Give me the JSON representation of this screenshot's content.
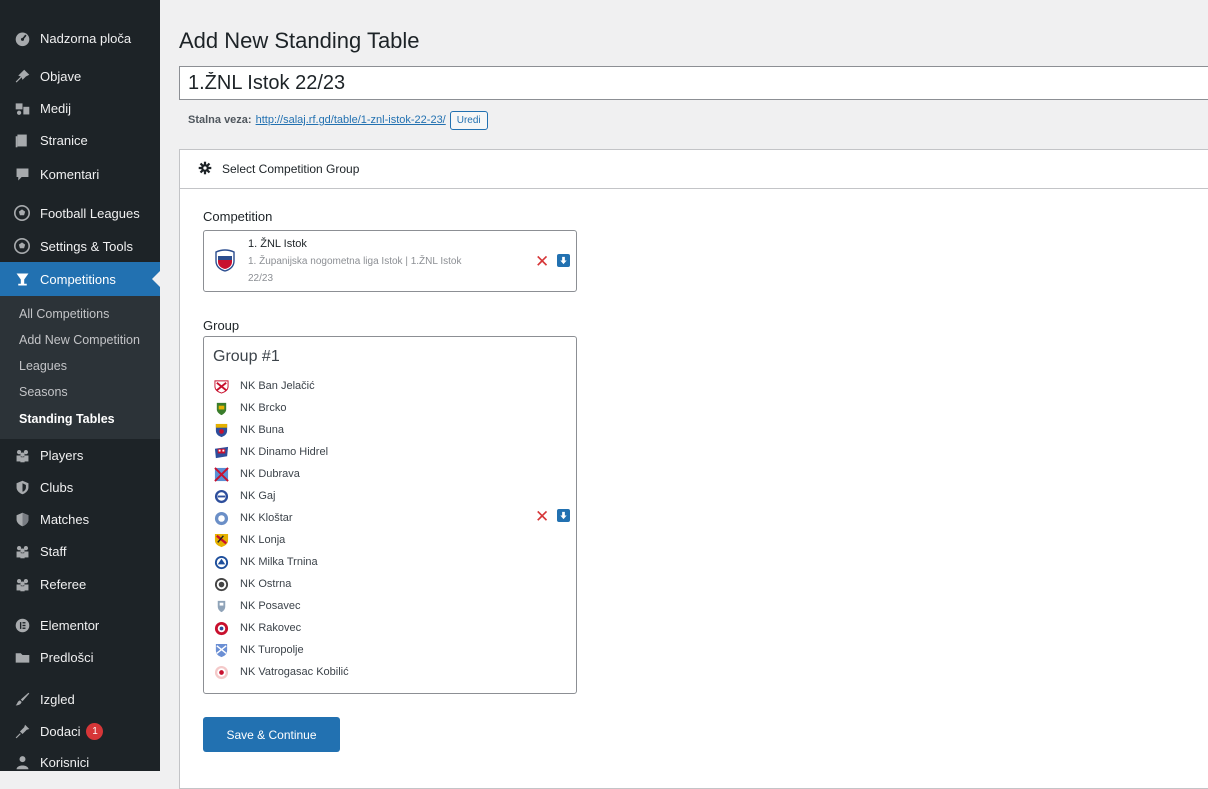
{
  "sidebar": {
    "items": [
      {
        "label": "Nadzorna ploča",
        "icon": "dashboard-icon"
      },
      {
        "label": "Objave",
        "icon": "pin-icon"
      },
      {
        "label": "Medij",
        "icon": "media-icon"
      },
      {
        "label": "Stranice",
        "icon": "pages-icon"
      },
      {
        "label": "Komentari",
        "icon": "comment-icon"
      },
      {
        "label": "Football Leagues",
        "icon": "football-icon"
      },
      {
        "label": "Settings & Tools",
        "icon": "football-icon"
      },
      {
        "label": "Competitions",
        "icon": "trophy-icon"
      },
      {
        "label": "Players",
        "icon": "groups-icon"
      },
      {
        "label": "Clubs",
        "icon": "shield-icon"
      },
      {
        "label": "Matches",
        "icon": "shield-half-icon"
      },
      {
        "label": "Staff",
        "icon": "groups-icon"
      },
      {
        "label": "Referee",
        "icon": "groups-icon"
      },
      {
        "label": "Elementor",
        "icon": "elementor-icon"
      },
      {
        "label": "Predlošci",
        "icon": "folder-icon"
      },
      {
        "label": "Izgled",
        "icon": "brush-icon"
      },
      {
        "label": "Dodaci",
        "icon": "plugin-icon",
        "badge": "1"
      },
      {
        "label": "Korisnici",
        "icon": "user-icon"
      }
    ],
    "submenu": [
      {
        "label": "All Competitions"
      },
      {
        "label": "Add New Competition"
      },
      {
        "label": "Leagues"
      },
      {
        "label": "Seasons"
      },
      {
        "label": "Standing Tables"
      }
    ]
  },
  "main": {
    "page_title": "Add New Standing Table",
    "title_value": "1.ŽNL Istok 22/23",
    "permalink_label": "Stalna veza:",
    "permalink_url": "http://salaj.rf.gd/table/1-znl-istok-22-23/",
    "permalink_edit": "Uredi",
    "panel_title": "Select Competition Group",
    "competition_label": "Competition",
    "competition": {
      "name": "1. ŽNL Istok",
      "desc": "1. Županijska nogometna liga Istok | 1.ŽNL Istok 22/23"
    },
    "group_label": "Group",
    "group": {
      "title": "Group #1",
      "teams": [
        "NK Ban Jelačić",
        "NK Brcko",
        "NK Buna",
        "NK Dinamo Hidrel",
        "NK Dubrava",
        "NK Gaj",
        "NK Kloštar",
        "NK Lonja",
        "NK Milka Trnina",
        "NK Ostrna",
        "NK Posavec",
        "NK Rakovec",
        "NK Turopolje",
        "NK Vatrogasac Kobilić"
      ]
    },
    "remove_symbol": "✕",
    "save_label": "Save & Continue"
  },
  "colors": {
    "sidebar_bg": "#1d2327",
    "submenu_bg": "#2c3338",
    "accent": "#2271b1",
    "remove_red": "#d63638",
    "page_bg": "#f0f0f1"
  }
}
